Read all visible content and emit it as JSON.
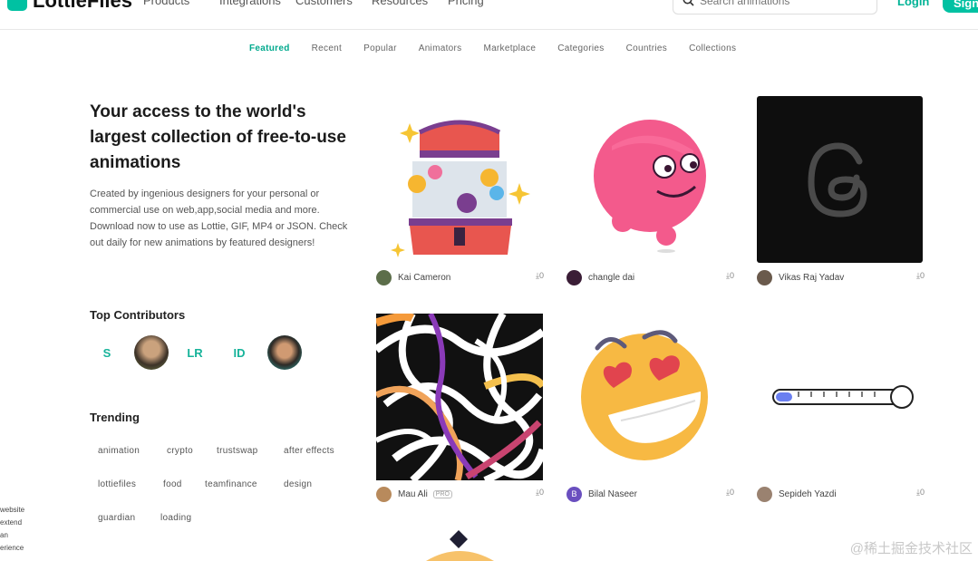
{
  "brand": {
    "name": "LottieFiles",
    "color": "#00c1a2"
  },
  "nav": {
    "items": [
      "Products",
      "Integrations",
      "Customers",
      "Resources",
      "Pricing"
    ],
    "search_placeholder": "Search animations",
    "login": "Login",
    "signup": "Sign"
  },
  "subnav": [
    "Featured",
    "Recent",
    "Popular",
    "Animators",
    "Marketplace",
    "Categories",
    "Countries",
    "Collections"
  ],
  "hero": {
    "title": "Your access to the world's largest collection of free-to-use animations",
    "description": "Created by ingenious designers for your personal or commercial use on web,app,social media and more. Download now to use as Lottie, GIF, MP4 or JSON. Check out daily for new animations by featured designers!"
  },
  "contributors": {
    "title": "Top Contributors",
    "items": [
      {
        "label": "S",
        "type": "initials"
      },
      {
        "label": "",
        "type": "photo"
      },
      {
        "label": "LR",
        "type": "initials"
      },
      {
        "label": "ID",
        "type": "initials"
      },
      {
        "label": "",
        "type": "photo"
      }
    ]
  },
  "trending": {
    "title": "Trending",
    "tags": [
      "animation",
      "crypto",
      "trustswap",
      "after effects",
      "lottiefiles",
      "food",
      "teamfinance",
      "design",
      "guardian",
      "loading"
    ]
  },
  "side_text": [
    "website",
    "extend",
    "an",
    "erience"
  ],
  "animations": [
    {
      "author": "Kai Cameron",
      "downloads": "0",
      "pro": false,
      "subject": "treasure-chest"
    },
    {
      "author": "changle dai",
      "downloads": "0",
      "pro": false,
      "subject": "pink-ball-character"
    },
    {
      "author": "Vikas Raj Yadav",
      "downloads": "0",
      "pro": false,
      "subject": "threads-logo"
    },
    {
      "author": "Mau Ali",
      "downloads": "0",
      "pro": true,
      "pro_label": "PRO",
      "subject": "abstract-lines"
    },
    {
      "author": "Bilal Naseer",
      "downloads": "0",
      "pro": false,
      "subject": "heart-eyes-emoji"
    },
    {
      "author": "Sepideh Yazdi",
      "downloads": "0",
      "pro": false,
      "subject": "loading-thermometer"
    }
  ],
  "watermark": "@稀土掘金技术社区"
}
